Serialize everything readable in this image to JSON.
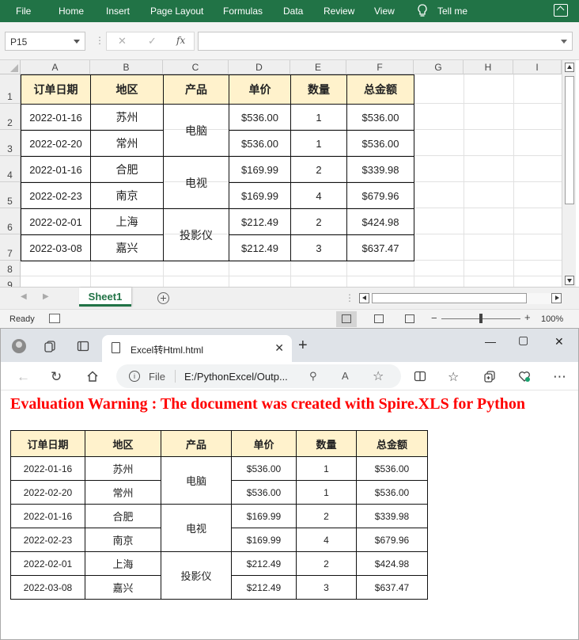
{
  "excel": {
    "ribbon_tabs": [
      "File",
      "Home",
      "Insert",
      "Page Layout",
      "Formulas",
      "Data",
      "Review",
      "View"
    ],
    "tell_me": "Tell me",
    "name_box": "P15",
    "fx_label": "fx",
    "formula_value": "",
    "column_headers": [
      "A",
      "B",
      "C",
      "D",
      "E",
      "F",
      "G",
      "H",
      "I"
    ],
    "row_headers": [
      "1",
      "2",
      "3",
      "4",
      "5",
      "6",
      "7",
      "8",
      "9"
    ],
    "sheet_tab": "Sheet1",
    "status": "Ready",
    "zoom": "100%"
  },
  "table": {
    "headers": [
      "订单日期",
      "地区",
      "产品",
      "单价",
      "数量",
      "总金额"
    ],
    "rows": [
      {
        "date": "2022-01-16",
        "region": "苏州",
        "price": "$536.00",
        "qty": "1",
        "total": "$536.00"
      },
      {
        "date": "2022-02-20",
        "region": "常州",
        "price": "$536.00",
        "qty": "1",
        "total": "$536.00"
      },
      {
        "date": "2022-01-16",
        "region": "合肥",
        "price": "$169.99",
        "qty": "2",
        "total": "$339.98"
      },
      {
        "date": "2022-02-23",
        "region": "南京",
        "price": "$169.99",
        "qty": "4",
        "total": "$679.96"
      },
      {
        "date": "2022-02-01",
        "region": "上海",
        "price": "$212.49",
        "qty": "2",
        "total": "$424.98"
      },
      {
        "date": "2022-03-08",
        "region": "嘉兴",
        "price": "$212.49",
        "qty": "3",
        "total": "$637.47"
      }
    ],
    "products": [
      "电脑",
      "电视",
      "投影仪"
    ],
    "header_fill": "#fff2cc"
  },
  "browser": {
    "tab_title": "Excel转Html.html",
    "file_label": "File",
    "url": "E:/PythonExcel/Outp...",
    "warning": "Evaluation Warning : The document was created with  Spire.XLS for Python",
    "warning_color": "#ff0000"
  },
  "colors": {
    "excel_green": "#217346"
  }
}
